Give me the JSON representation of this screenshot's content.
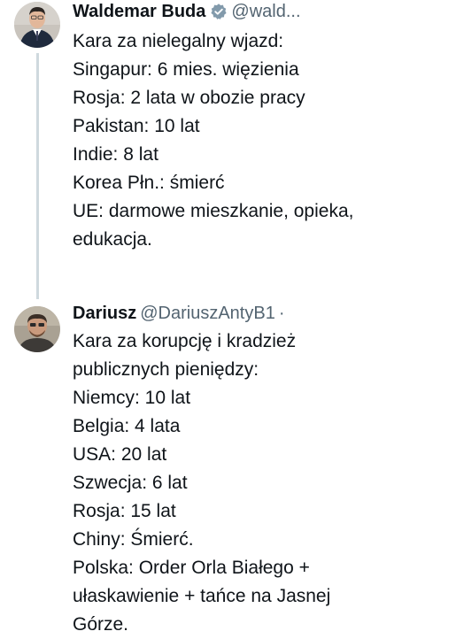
{
  "tweets": [
    {
      "display_name": "Waldemar Buda",
      "handle": "@wald...",
      "verified": true,
      "badge_icon": "verified-badge-icon",
      "avatar_icon": "user-avatar-photo",
      "lines": [
        "Kara za nielegalny wjazd:",
        "Singapur: 6 mies. więzienia",
        "Rosja: 2 lata w obozie pracy",
        "Pakistan: 10 lat",
        "Indie: 8 lat",
        "Korea Płn.: śmierć",
        "UE: darmowe mieszkanie, opieka,",
        "edukacja."
      ]
    },
    {
      "display_name": "Dariusz",
      "handle": "@DariuszAntyB1",
      "separator": "·",
      "avatar_icon": "user-avatar-photo",
      "lines": [
        "Kara za korupcję i kradzież",
        "publicznych pieniędzy:",
        "Niemcy: 10 lat",
        "Belgia: 4 lata",
        "USA: 20 lat",
        "Szwecja: 6 lat",
        "Rosja: 15 lat",
        "Chiny: Śmierć.",
        "Polska: Order Orla Białego +",
        "ułaskawienie + tańce na Jasnej",
        "Górze."
      ]
    }
  ],
  "colors": {
    "text": "#0f1419",
    "secondary": "#536471",
    "thread_line": "#cfd9de",
    "verified_badge": "#829aab"
  }
}
